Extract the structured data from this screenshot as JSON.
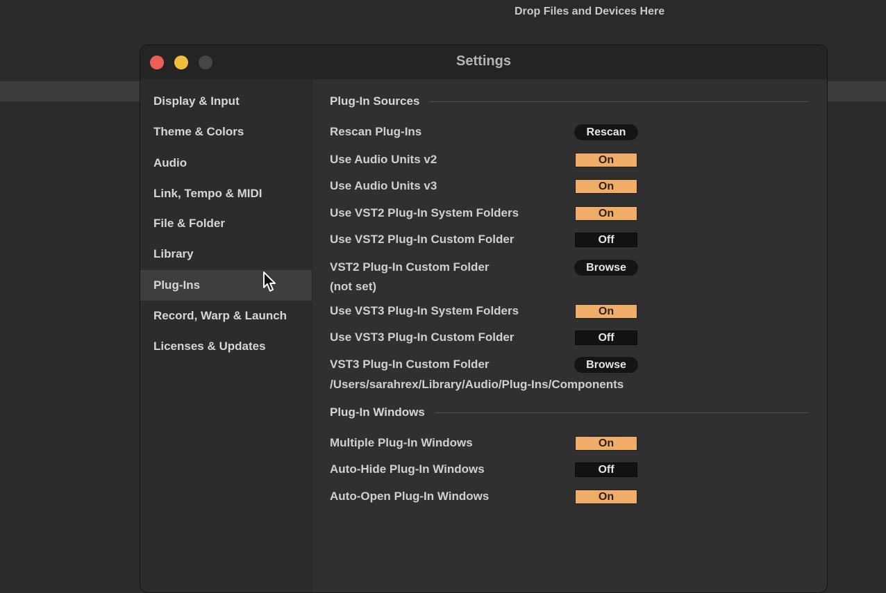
{
  "background": {
    "drop_label": "Drop Files and Devices Here"
  },
  "window": {
    "title": "Settings"
  },
  "sidebar": {
    "items": [
      {
        "label": "Display & Input"
      },
      {
        "label": "Theme & Colors"
      },
      {
        "label": "Audio"
      },
      {
        "label": "Link, Tempo & MIDI"
      },
      {
        "label": "File & Folder"
      },
      {
        "label": "Library"
      },
      {
        "label": "Plug-Ins",
        "selected": true
      },
      {
        "label": "Record, Warp & Launch"
      },
      {
        "label": "Licenses & Updates"
      }
    ]
  },
  "plugin_sources": {
    "heading": "Plug-In Sources",
    "rescan": {
      "label": "Rescan Plug-Ins",
      "button": "Rescan"
    },
    "au_v2": {
      "label": "Use Audio Units v2",
      "value": "On"
    },
    "au_v3": {
      "label": "Use Audio Units v3",
      "value": "On"
    },
    "vst2_system": {
      "label": "Use VST2 Plug-In System Folders",
      "value": "On"
    },
    "vst2_custom": {
      "label": "Use VST2 Plug-In Custom Folder",
      "value": "Off"
    },
    "vst2_folder": {
      "label": "VST2 Plug-In Custom Folder",
      "button": "Browse",
      "path": "(not set)"
    },
    "vst3_system": {
      "label": "Use VST3 Plug-In System Folders",
      "value": "On"
    },
    "vst3_custom": {
      "label": "Use VST3 Plug-In Custom Folder",
      "value": "Off"
    },
    "vst3_folder": {
      "label": "VST3 Plug-In Custom Folder",
      "button": "Browse",
      "path": "/Users/sarahrex/Library/Audio/Plug-Ins/Components"
    }
  },
  "plugin_windows": {
    "heading": "Plug-In Windows",
    "multiple": {
      "label": "Multiple Plug-In Windows",
      "value": "On"
    },
    "auto_hide": {
      "label": "Auto-Hide Plug-In Windows",
      "value": "Off"
    },
    "auto_open": {
      "label": "Auto-Open Plug-In Windows",
      "value": "On"
    }
  },
  "colors": {
    "toggle_on": "#f0ad68",
    "toggle_off": "#121212",
    "close": "#ec5f57",
    "minimize": "#f0bd3c"
  }
}
